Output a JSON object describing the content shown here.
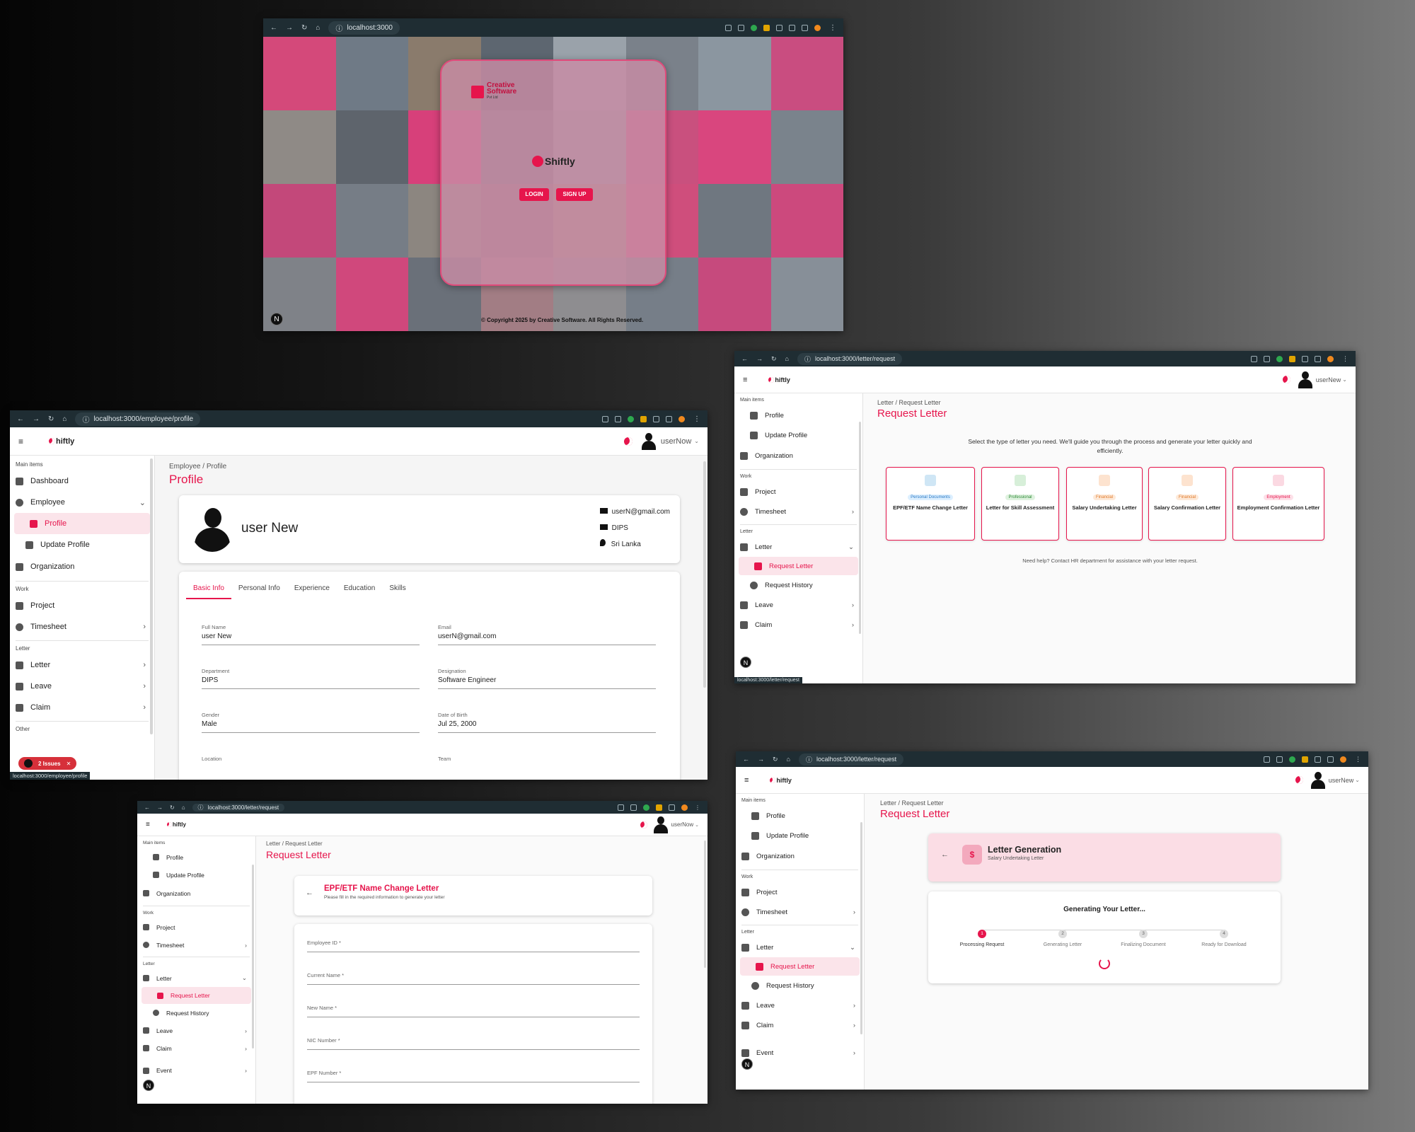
{
  "login": {
    "url": "localhost:3000",
    "company_brand": "Creative Software",
    "company_suffix": "Pvt Ltd",
    "app_logo": "Shiftly",
    "login_label": "LOGIN",
    "signup_label": "SIGN UP",
    "copyright": "© Copyright 2025 by Creative Software. All Rights Reserved."
  },
  "common": {
    "logo_text": "hiftly",
    "sidebar": {
      "main_items": "Main items",
      "work": "Work",
      "letter_section": "Letter",
      "other": "Other",
      "dashboard": "Dashboard",
      "employee": "Employee",
      "profile": "Profile",
      "update_profile": "Update Profile",
      "organization": "Organization",
      "project": "Project",
      "timesheet": "Timesheet",
      "letter": "Letter",
      "request_letter": "Request Letter",
      "request_history": "Request History",
      "leave": "Leave",
      "claim": "Claim",
      "event": "Event"
    },
    "breadcrumb_letter": "Letter",
    "breadcrumb_request": "Request Letter",
    "page_title_request": "Request Letter",
    "n_badge": "N"
  },
  "profile_win": {
    "url": "localhost:3000/employee/profile",
    "username": "userNow",
    "breadcrumb_root": "Employee",
    "breadcrumb_leaf": "Profile",
    "page_title": "Profile",
    "display_name": "user New",
    "email": "userN@gmail.com",
    "department": "DIPS",
    "country": "Sri Lanka",
    "tabs": [
      "Basic Info",
      "Personal Info",
      "Experience",
      "Education",
      "Skills"
    ],
    "fields": {
      "full_name_label": "Full Name",
      "full_name": "user New",
      "email_label": "Email",
      "email": "userN@gmail.com",
      "department_label": "Department",
      "department": "DIPS",
      "designation_label": "Designation",
      "designation": "Software Engineer",
      "gender_label": "Gender",
      "gender": "Male",
      "dob_label": "Date of Birth",
      "dob": "Jul 25, 2000",
      "location_label": "Location",
      "team_label": "Team"
    },
    "issues": "2 Issues",
    "status_url": "localhost:3000/employee/profile"
  },
  "request_win": {
    "url": "localhost:3000/letter/request",
    "username": "userNew",
    "intro": "Select the type of letter you need. We'll guide you through the process and generate your letter quickly and efficiently.",
    "tiles": [
      {
        "category": "Personal Documents",
        "name": "EPF/ETF Name Change Letter",
        "icon": "document-icon"
      },
      {
        "category": "Professional",
        "name": "Letter for Skill Assessment",
        "icon": "briefcase-icon"
      },
      {
        "category": "Financial",
        "name": "Salary Undertaking Letter",
        "icon": "dollar-icon"
      },
      {
        "category": "Financial",
        "name": "Salary Confirmation Letter",
        "icon": "shield-icon"
      },
      {
        "category": "Employment",
        "name": "Employment Confirmation Letter",
        "icon": "badge-icon"
      }
    ],
    "help": "Need help? Contact HR department for assistance with your letter request.",
    "status_url": "localhost:3000/letter/request"
  },
  "form_win": {
    "url": "localhost:3000/letter/request",
    "username": "userNow",
    "form_title": "EPF/ETF Name Change Letter",
    "form_subtitle": "Please fill in the required information to generate your letter",
    "fields": [
      "Employee ID *",
      "Current Name *",
      "New Name *",
      "NIC Number *",
      "EPF Number *"
    ]
  },
  "gen_win": {
    "url": "localhost:3000/letter/request",
    "username": "userNew",
    "header_title": "Letter Generation",
    "header_subtitle": "Salary Undertaking Letter",
    "generating": "Generating Your Letter...",
    "steps": [
      {
        "n": "1",
        "label": "Processing Request"
      },
      {
        "n": "2",
        "label": "Generating Letter"
      },
      {
        "n": "3",
        "label": "Finalizing Document"
      },
      {
        "n": "4",
        "label": "Ready for Download"
      }
    ]
  },
  "colors": {
    "accent": "#e6154c",
    "chrome": "#1f2d33"
  }
}
